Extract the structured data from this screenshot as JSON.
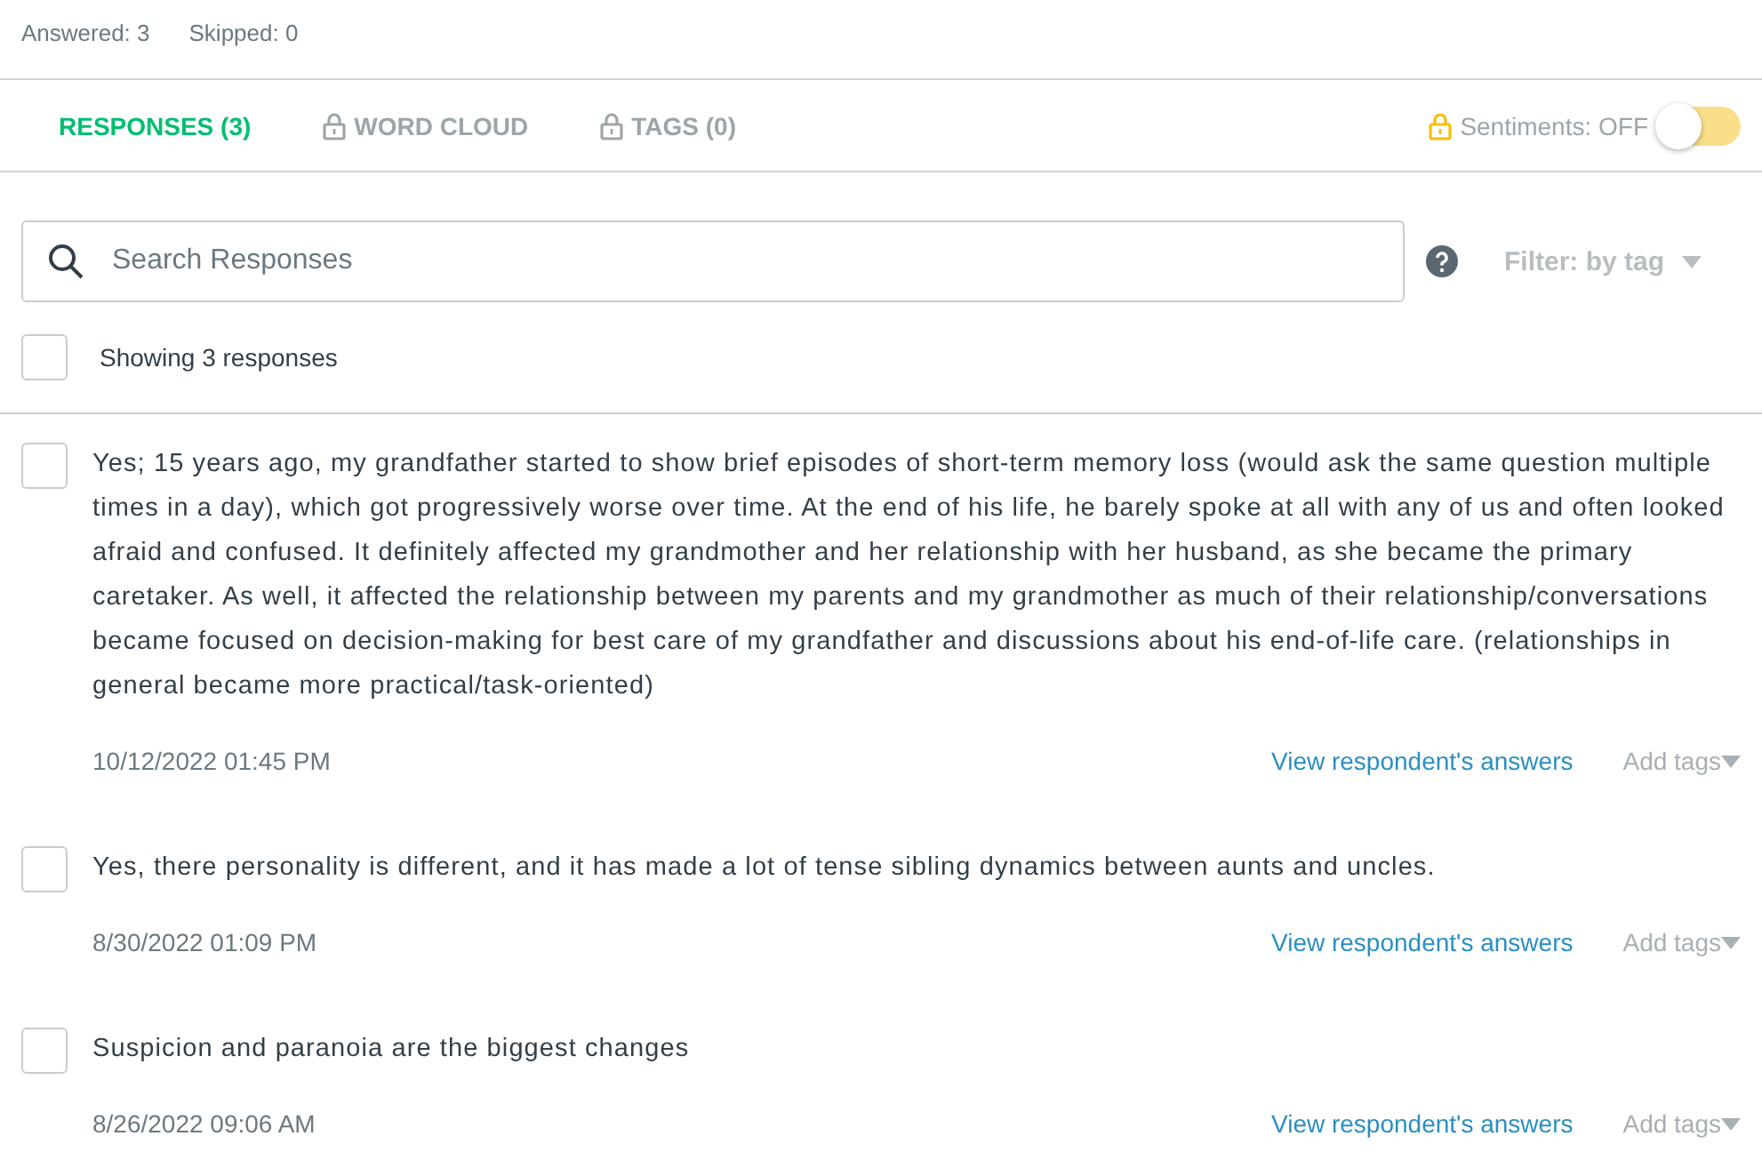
{
  "stats": [
    "Answered: 3",
    "Skipped: 0"
  ],
  "tabs": [
    {
      "label": "RESPONSES (3)",
      "selected": true,
      "locked": false
    },
    {
      "label": "WORD CLOUD",
      "selected": false,
      "locked": true
    },
    {
      "label": "TAGS (0)",
      "selected": false,
      "locked": true
    }
  ],
  "sentiments": {
    "label": "Sentiments: OFF",
    "on": false
  },
  "search": {
    "placeholder": "Search Responses"
  },
  "filter": {
    "label": "Filter: by tag"
  },
  "select_all": {
    "checked": false,
    "label": "Showing 3 responses"
  },
  "responses": [
    {
      "checked": false,
      "text": "Yes; 15 years ago, my grandfather started to show brief episodes of short-term memory loss (would ask the same question multiple times in a day), which got progressively worse over time. At the end of his life, he barely spoke at all with any of us and often looked afraid and confused. It definitely affected my grandmother and her relationship with her husband, as she became the primary caretaker. As well, it affected the relationship between my parents and my grandmother as much of their relationship/conversations became focused on decision-making for best care of my grandfather and discussions about his end-of-life care. (relationships in general became more practical/task-oriented)",
      "date": "10/12/2022 01:45 PM",
      "link": "View respondent's answers",
      "tags": "Add tags"
    },
    {
      "checked": false,
      "text": "Yes, there personality is different, and it has made a lot of tense sibling dynamics between aunts and uncles.",
      "date": "8/30/2022 01:09 PM",
      "link": "View respondent's answers",
      "tags": "Add tags"
    },
    {
      "checked": false,
      "text": "Suspicion and paranoia are the biggest changes",
      "date": "8/26/2022 09:06 AM",
      "link": "View respondent's answers",
      "tags": "Add tags"
    }
  ]
}
